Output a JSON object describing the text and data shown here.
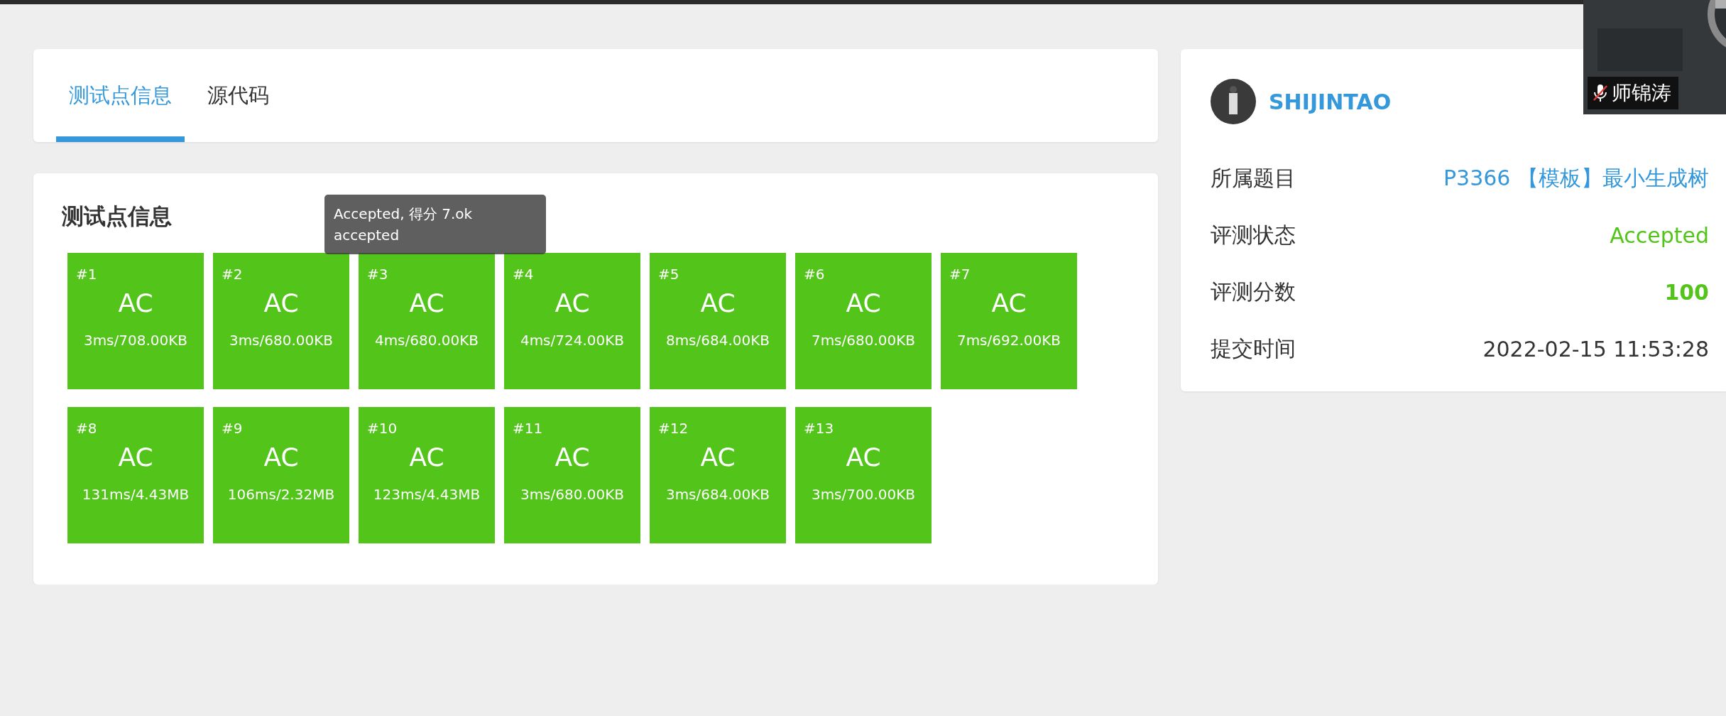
{
  "tabs": [
    {
      "label": "测试点信息",
      "selected": true
    },
    {
      "label": "源代码",
      "selected": false
    }
  ],
  "testcases": {
    "title": "测试点信息",
    "cases": [
      {
        "id": "#1",
        "status": "AC",
        "detail": "3ms/708.00KB",
        "color": "#52c41a"
      },
      {
        "id": "#2",
        "status": "AC",
        "detail": "3ms/680.00KB",
        "color": "#52c41a"
      },
      {
        "id": "#3",
        "status": "AC",
        "detail": "4ms/680.00KB",
        "color": "#52c41a"
      },
      {
        "id": "#4",
        "status": "AC",
        "detail": "4ms/724.00KB",
        "color": "#52c41a"
      },
      {
        "id": "#5",
        "status": "AC",
        "detail": "8ms/684.00KB",
        "color": "#52c41a"
      },
      {
        "id": "#6",
        "status": "AC",
        "detail": "7ms/680.00KB",
        "color": "#52c41a"
      },
      {
        "id": "#7",
        "status": "AC",
        "detail": "7ms/692.00KB",
        "color": "#52c41a"
      },
      {
        "id": "#8",
        "status": "AC",
        "detail": "131ms/4.43MB",
        "color": "#52c41a"
      },
      {
        "id": "#9",
        "status": "AC",
        "detail": "106ms/2.32MB",
        "color": "#52c41a"
      },
      {
        "id": "#10",
        "status": "AC",
        "detail": "123ms/4.43MB",
        "color": "#52c41a"
      },
      {
        "id": "#11",
        "status": "AC",
        "detail": "3ms/680.00KB",
        "color": "#52c41a"
      },
      {
        "id": "#12",
        "status": "AC",
        "detail": "3ms/684.00KB",
        "color": "#52c41a"
      },
      {
        "id": "#13",
        "status": "AC",
        "detail": "3ms/700.00KB",
        "color": "#52c41a"
      }
    ]
  },
  "tooltip": {
    "lines": [
      "Accepted, 得分 7.ok",
      "accepted"
    ]
  },
  "submission": {
    "user": "SHIJINTAO",
    "rows": [
      {
        "label": "所属题目",
        "value": "P3366 【模板】最小生成树",
        "kind": "link"
      },
      {
        "label": "评测状态",
        "value": "Accepted",
        "kind": "status"
      },
      {
        "label": "评测分数",
        "value": "100",
        "kind": "score"
      },
      {
        "label": "提交时间",
        "value": "2022-02-15 11:53:28",
        "kind": "text"
      }
    ]
  },
  "video_overlay": {
    "name": "师锦涛",
    "muted": true
  }
}
